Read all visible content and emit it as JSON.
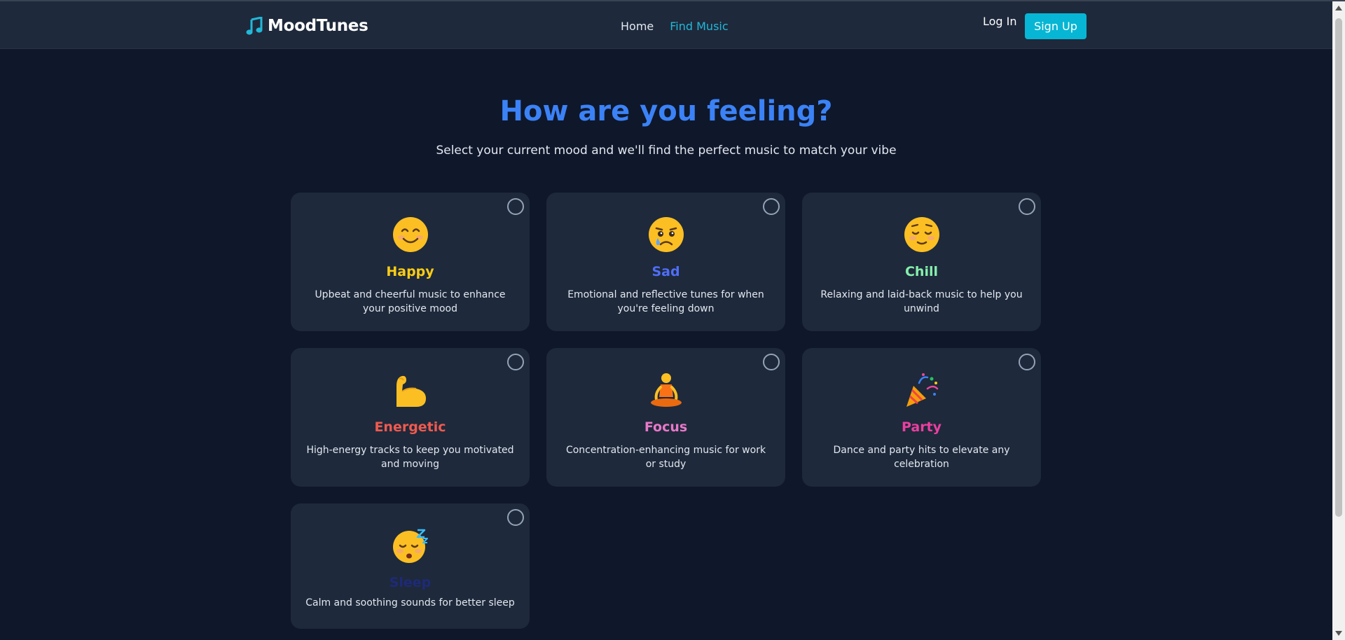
{
  "app": {
    "name": "MoodTunes",
    "logo_icon": "music-note-icon",
    "accent": "#06b6d4"
  },
  "nav": {
    "links": [
      {
        "label": "Home",
        "active": false
      },
      {
        "label": "Find Music",
        "active": true
      }
    ],
    "login_label": "Log In",
    "signup_label": "Sign Up"
  },
  "hero": {
    "title": "How are you feeling?",
    "subtitle": "Select your current mood and we'll find the perfect music to match your vibe"
  },
  "moods": [
    {
      "name": "Happy",
      "color": "#facc15",
      "icon": "smiling-face-icon",
      "description": "Upbeat and cheerful music to enhance your positive mood",
      "selected": false
    },
    {
      "name": "Sad",
      "color": "#4f6ef7",
      "icon": "crying-face-icon",
      "description": "Emotional and reflective tunes for when you're feeling down",
      "selected": false
    },
    {
      "name": "Chill",
      "color": "#86efac",
      "icon": "relieved-face-icon",
      "description": "Relaxing and laid-back music to help you unwind",
      "selected": false
    },
    {
      "name": "Energetic",
      "color": "#f05a4f",
      "icon": "flexed-biceps-icon",
      "description": "High-energy tracks to keep you motivated and moving",
      "selected": false
    },
    {
      "name": "Focus",
      "color": "#e879c9",
      "icon": "meditating-person-icon",
      "description": "Concentration-enhancing music for work or study",
      "selected": false
    },
    {
      "name": "Party",
      "color": "#ec3fa0",
      "icon": "party-popper-icon",
      "description": "Dance and party hits to elevate any celebration",
      "selected": false
    },
    {
      "name": "Sleep",
      "color": "#1e2a78",
      "icon": "sleeping-face-icon",
      "description": "Calm and soothing sounds for better sleep",
      "selected": false
    }
  ]
}
